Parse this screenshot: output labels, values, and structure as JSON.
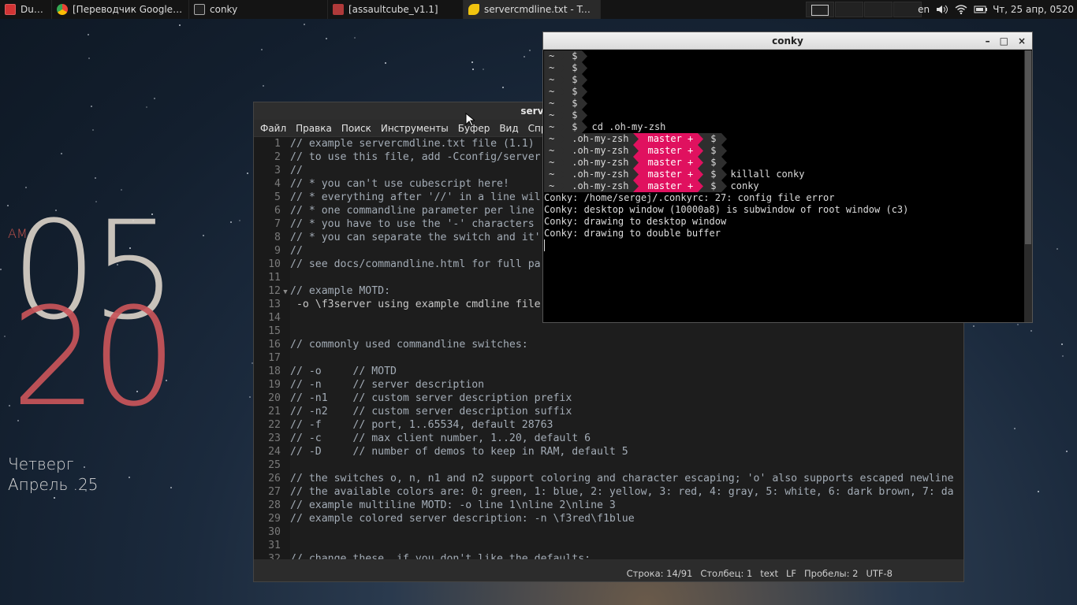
{
  "panel": {
    "tasks": [
      {
        "label": "Dump",
        "icon": "terminal-red-icon",
        "color": "#d33434"
      },
      {
        "label": "[Переводчик Google - Go...",
        "icon": "chrome-icon",
        "color": "#4c8bf5"
      },
      {
        "label": "conky",
        "icon": "terminal-icon",
        "color": "#888888"
      },
      {
        "label": "[assaultcube_v1.1]",
        "icon": "folder-icon",
        "color": "#c0392b"
      },
      {
        "label": "servercmdline.txt - Textad...",
        "icon": "textadept-icon",
        "color": "#f1c40f"
      }
    ],
    "layout": "en",
    "clock": "Чт, 25 апр, 0520"
  },
  "conky_clock": {
    "ampm": "AM",
    "hour": "05",
    "minute": "20",
    "weekday": "Четверг",
    "date": "Апрель .25",
    "colors": {
      "hour": "#d8d0c6",
      "minute": "#c9555a"
    }
  },
  "textadept": {
    "title": "servercmdline.txt - Textadept (/h",
    "menu": [
      "Файл",
      "Правка",
      "Поиск",
      "Инструменты",
      "Буфер",
      "Вид",
      "Справка"
    ],
    "lines": [
      {
        "n": "1",
        "text": "// example servercmdline.txt file (1.1)"
      },
      {
        "n": "2",
        "text": "// to use this file, add -Cconfig/server"
      },
      {
        "n": "3",
        "text": "//"
      },
      {
        "n": "4",
        "text": "// * you can't use cubescript here!"
      },
      {
        "n": "5",
        "text": "// * everything after '//' in a line wil"
      },
      {
        "n": "6",
        "text": "// * one commandline parameter per line"
      },
      {
        "n": "7",
        "text": "// * you have to use the '-' characters"
      },
      {
        "n": "8",
        "text": "// * you can separate the switch and it'"
      },
      {
        "n": "9",
        "text": "//"
      },
      {
        "n": "10",
        "text": "// see docs/commandline.html for full pa"
      },
      {
        "n": "11",
        "text": ""
      },
      {
        "n": "12",
        "text": "// example MOTD:",
        "fold": "▼"
      },
      {
        "n": "13",
        "text": " -o \\f3server using example cmdline file",
        "plain": true
      },
      {
        "n": "14",
        "text": ""
      },
      {
        "n": "15",
        "text": ""
      },
      {
        "n": "16",
        "text": "// commonly used commandline switches:"
      },
      {
        "n": "17",
        "text": ""
      },
      {
        "n": "18",
        "text": "// -o     // MOTD"
      },
      {
        "n": "19",
        "text": "// -n     // server description"
      },
      {
        "n": "20",
        "text": "// -n1    // custom server description prefix"
      },
      {
        "n": "21",
        "text": "// -n2    // custom server description suffix"
      },
      {
        "n": "22",
        "text": "// -f     // port, 1..65534, default 28763"
      },
      {
        "n": "23",
        "text": "// -c     // max client number, 1..20, default 6"
      },
      {
        "n": "24",
        "text": "// -D     // number of demos to keep in RAM, default 5"
      },
      {
        "n": "25",
        "text": ""
      },
      {
        "n": "26",
        "text": "// the switches o, n, n1 and n2 support coloring and character escaping; 'o' also supports escaped newline"
      },
      {
        "n": "27",
        "text": "// the available colors are: 0: green, 1: blue, 2: yellow, 3: red, 4: gray, 5: white, 6: dark brown, 7: da"
      },
      {
        "n": "28",
        "text": "// example multiline MOTD: -o line 1\\nline 2\\nline 3"
      },
      {
        "n": "29",
        "text": "// example colored server description: -n \\f3red\\f1blue"
      },
      {
        "n": "30",
        "text": ""
      },
      {
        "n": "31",
        "text": ""
      },
      {
        "n": "32",
        "text": "// change these, if you don't like the defaults:"
      }
    ],
    "status": {
      "line": "Строка: 14/91",
      "column": "Столбец: 1",
      "lexer": "text",
      "eol": "LF",
      "indent": "Пробелы: 2",
      "encoding": "UTF-8"
    }
  },
  "terminal": {
    "title": "conky",
    "buttons": {
      "minimize": "–",
      "maximize": "□",
      "close": "×"
    },
    "prompt_home": "~",
    "prompt_dollar": "$",
    "lines": [
      {
        "dir": "",
        "branch": "",
        "cmd": ""
      },
      {
        "dir": "",
        "branch": "",
        "cmd": ""
      },
      {
        "dir": "",
        "branch": "",
        "cmd": ""
      },
      {
        "dir": "",
        "branch": "",
        "cmd": ""
      },
      {
        "dir": "",
        "branch": "",
        "cmd": ""
      },
      {
        "dir": "",
        "branch": "",
        "cmd": ""
      },
      {
        "dir": "",
        "branch": "",
        "cmd": "cd .oh-my-zsh"
      },
      {
        "dir": ".oh-my-zsh",
        "branch": "master +",
        "cmd": ""
      },
      {
        "dir": ".oh-my-zsh",
        "branch": "master +",
        "cmd": ""
      },
      {
        "dir": ".oh-my-zsh",
        "branch": "master +",
        "cmd": ""
      },
      {
        "dir": ".oh-my-zsh",
        "branch": "master +",
        "cmd": "killall conky"
      },
      {
        "dir": ".oh-my-zsh",
        "branch": "master +",
        "cmd": "conky"
      }
    ],
    "output": [
      "Conky: /home/sergej/.conkyrc: 27: config file error",
      "Conky: desktop window (10000a8) is subwindow of root window (c3)",
      "Conky: drawing to desktop window",
      "Conky: drawing to double buffer"
    ],
    "accent": "#e0115f"
  }
}
